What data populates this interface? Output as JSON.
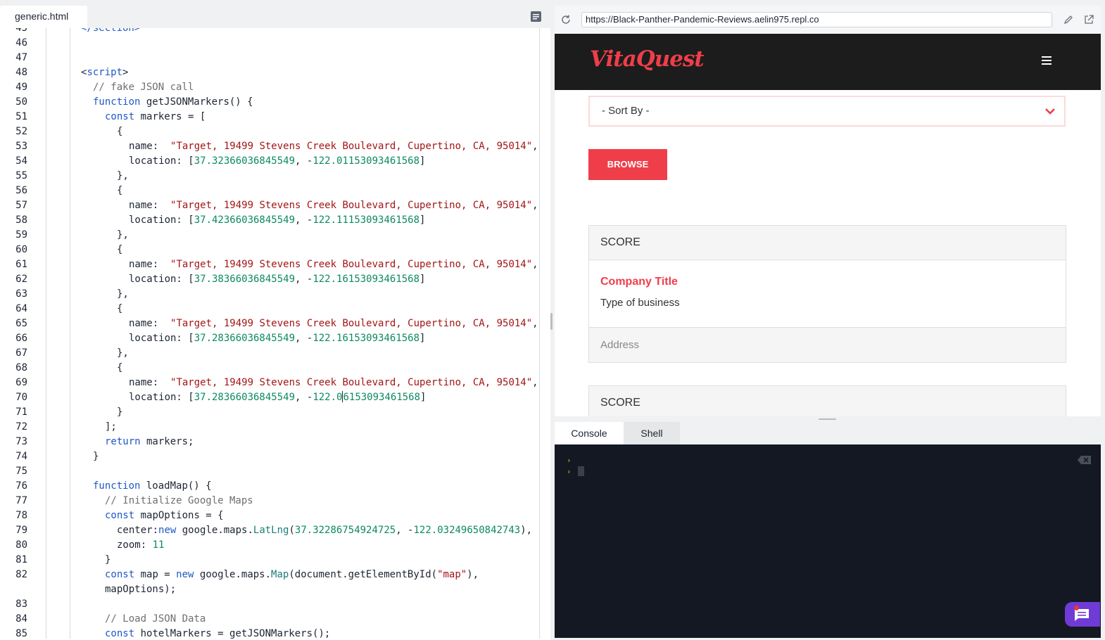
{
  "editor": {
    "tab_label": "generic.html",
    "lines": [
      {
        "n": "45",
        "indent": 0,
        "tokens": [
          {
            "t": "</",
            "c": "tag"
          },
          {
            "t": "section",
            "c": "tag"
          },
          {
            "t": ">",
            "c": "tag"
          }
        ]
      },
      {
        "n": "46",
        "indent": 0,
        "tokens": []
      },
      {
        "n": "47",
        "indent": 0,
        "tokens": []
      },
      {
        "n": "48",
        "indent": 0,
        "tokens": [
          {
            "t": "<",
            "c": "plain"
          },
          {
            "t": "script",
            "c": "tag"
          },
          {
            "t": ">",
            "c": "plain"
          }
        ]
      },
      {
        "n": "49",
        "indent": 1,
        "tokens": [
          {
            "t": "// fake JSON call",
            "c": "cmt"
          }
        ]
      },
      {
        "n": "50",
        "indent": 1,
        "tokens": [
          {
            "t": "function",
            "c": "kw"
          },
          {
            "t": " getJSONMarkers() {",
            "c": "plain"
          }
        ]
      },
      {
        "n": "51",
        "indent": 2,
        "tokens": [
          {
            "t": "const",
            "c": "kw"
          },
          {
            "t": " markers = [",
            "c": "plain"
          }
        ]
      },
      {
        "n": "52",
        "indent": 3,
        "tokens": [
          {
            "t": "{",
            "c": "plain"
          }
        ]
      },
      {
        "n": "53",
        "indent": 4,
        "tokens": [
          {
            "t": "name:  ",
            "c": "plain"
          },
          {
            "t": "\"Target, 19499 Stevens Creek Boulevard, Cupertino, CA, 95014\"",
            "c": "str"
          },
          {
            "t": ",",
            "c": "plain"
          }
        ]
      },
      {
        "n": "54",
        "indent": 4,
        "tokens": [
          {
            "t": "location: [",
            "c": "plain"
          },
          {
            "t": "37.32366036845549",
            "c": "num"
          },
          {
            "t": ", -",
            "c": "plain"
          },
          {
            "t": "122.01153093461568",
            "c": "num"
          },
          {
            "t": "]",
            "c": "plain"
          }
        ]
      },
      {
        "n": "55",
        "indent": 3,
        "tokens": [
          {
            "t": "},",
            "c": "plain"
          }
        ]
      },
      {
        "n": "56",
        "indent": 3,
        "tokens": [
          {
            "t": "{",
            "c": "plain"
          }
        ]
      },
      {
        "n": "57",
        "indent": 4,
        "tokens": [
          {
            "t": "name:  ",
            "c": "plain"
          },
          {
            "t": "\"Target, 19499 Stevens Creek Boulevard, Cupertino, CA, 95014\"",
            "c": "str"
          },
          {
            "t": ",",
            "c": "plain"
          }
        ]
      },
      {
        "n": "58",
        "indent": 4,
        "tokens": [
          {
            "t": "location: [",
            "c": "plain"
          },
          {
            "t": "37.42366036845549",
            "c": "num"
          },
          {
            "t": ", -",
            "c": "plain"
          },
          {
            "t": "122.11153093461568",
            "c": "num"
          },
          {
            "t": "]",
            "c": "plain"
          }
        ]
      },
      {
        "n": "59",
        "indent": 3,
        "tokens": [
          {
            "t": "},",
            "c": "plain"
          }
        ]
      },
      {
        "n": "60",
        "indent": 3,
        "tokens": [
          {
            "t": "{",
            "c": "plain"
          }
        ]
      },
      {
        "n": "61",
        "indent": 4,
        "tokens": [
          {
            "t": "name:  ",
            "c": "plain"
          },
          {
            "t": "\"Target, 19499 Stevens Creek Boulevard, Cupertino, CA, 95014\"",
            "c": "str"
          },
          {
            "t": ",",
            "c": "plain"
          }
        ]
      },
      {
        "n": "62",
        "indent": 4,
        "tokens": [
          {
            "t": "location: [",
            "c": "plain"
          },
          {
            "t": "37.38366036845549",
            "c": "num"
          },
          {
            "t": ", -",
            "c": "plain"
          },
          {
            "t": "122.16153093461568",
            "c": "num"
          },
          {
            "t": "]",
            "c": "plain"
          }
        ]
      },
      {
        "n": "63",
        "indent": 3,
        "tokens": [
          {
            "t": "},",
            "c": "plain"
          }
        ]
      },
      {
        "n": "64",
        "indent": 3,
        "tokens": [
          {
            "t": "{",
            "c": "plain"
          }
        ]
      },
      {
        "n": "65",
        "indent": 4,
        "tokens": [
          {
            "t": "name:  ",
            "c": "plain"
          },
          {
            "t": "\"Target, 19499 Stevens Creek Boulevard, Cupertino, CA, 95014\"",
            "c": "str"
          },
          {
            "t": ",",
            "c": "plain"
          }
        ]
      },
      {
        "n": "66",
        "indent": 4,
        "tokens": [
          {
            "t": "location: [",
            "c": "plain"
          },
          {
            "t": "37.28366036845549",
            "c": "num"
          },
          {
            "t": ", -",
            "c": "plain"
          },
          {
            "t": "122.16153093461568",
            "c": "num"
          },
          {
            "t": "]",
            "c": "plain"
          }
        ]
      },
      {
        "n": "67",
        "indent": 3,
        "tokens": [
          {
            "t": "},",
            "c": "plain"
          }
        ]
      },
      {
        "n": "68",
        "indent": 3,
        "tokens": [
          {
            "t": "{",
            "c": "plain"
          }
        ]
      },
      {
        "n": "69",
        "indent": 4,
        "tokens": [
          {
            "t": "name:  ",
            "c": "plain"
          },
          {
            "t": "\"Target, 19499 Stevens Creek Boulevard, Cupertino, CA, 95014\"",
            "c": "str"
          },
          {
            "t": ",",
            "c": "plain"
          }
        ]
      },
      {
        "n": "70",
        "indent": 4,
        "tokens": [
          {
            "t": "location: [",
            "c": "plain"
          },
          {
            "t": "37.28366036845549",
            "c": "num"
          },
          {
            "t": ", -",
            "c": "plain"
          },
          {
            "t": "122.0",
            "c": "num"
          },
          {
            "t": "",
            "c": "caret"
          },
          {
            "t": "6153093461568",
            "c": "num"
          },
          {
            "t": "]",
            "c": "plain"
          }
        ]
      },
      {
        "n": "71",
        "indent": 3,
        "tokens": [
          {
            "t": "}",
            "c": "plain"
          }
        ]
      },
      {
        "n": "72",
        "indent": 2,
        "tokens": [
          {
            "t": "];",
            "c": "plain"
          }
        ]
      },
      {
        "n": "73",
        "indent": 2,
        "tokens": [
          {
            "t": "return",
            "c": "kw"
          },
          {
            "t": " markers;",
            "c": "plain"
          }
        ]
      },
      {
        "n": "74",
        "indent": 1,
        "tokens": [
          {
            "t": "}",
            "c": "plain"
          }
        ]
      },
      {
        "n": "75",
        "indent": 0,
        "tokens": []
      },
      {
        "n": "76",
        "indent": 1,
        "tokens": [
          {
            "t": "function",
            "c": "kw"
          },
          {
            "t": " loadMap() {",
            "c": "plain"
          }
        ]
      },
      {
        "n": "77",
        "indent": 2,
        "tokens": [
          {
            "t": "// Initialize Google Maps",
            "c": "cmt"
          }
        ]
      },
      {
        "n": "78",
        "indent": 2,
        "tokens": [
          {
            "t": "const",
            "c": "kw"
          },
          {
            "t": " mapOptions = {",
            "c": "plain"
          }
        ]
      },
      {
        "n": "79",
        "indent": 3,
        "tokens": [
          {
            "t": "center:",
            "c": "plain"
          },
          {
            "t": "new",
            "c": "kw"
          },
          {
            "t": " google.maps.",
            "c": "plain"
          },
          {
            "t": "LatLng",
            "c": "type"
          },
          {
            "t": "(",
            "c": "plain"
          },
          {
            "t": "37.32286754924725",
            "c": "num"
          },
          {
            "t": ", -",
            "c": "plain"
          },
          {
            "t": "122.03249650842743",
            "c": "num"
          },
          {
            "t": "),",
            "c": "plain"
          }
        ]
      },
      {
        "n": "80",
        "indent": 3,
        "tokens": [
          {
            "t": "zoom: ",
            "c": "plain"
          },
          {
            "t": "11",
            "c": "num"
          }
        ]
      },
      {
        "n": "81",
        "indent": 2,
        "tokens": [
          {
            "t": "}",
            "c": "plain"
          }
        ]
      },
      {
        "n": "82",
        "indent": 2,
        "wrap": true,
        "tokens": [
          {
            "t": "const",
            "c": "kw"
          },
          {
            "t": " map = ",
            "c": "plain"
          },
          {
            "t": "new",
            "c": "kw"
          },
          {
            "t": " google.maps.",
            "c": "plain"
          },
          {
            "t": "Map",
            "c": "type"
          },
          {
            "t": "(document.getElementById(",
            "c": "plain"
          },
          {
            "t": "\"map\"",
            "c": "str"
          },
          {
            "t": "),\nmapOptions);",
            "c": "plain"
          }
        ]
      },
      {
        "n": "83",
        "indent": 0,
        "tokens": []
      },
      {
        "n": "84",
        "indent": 2,
        "tokens": [
          {
            "t": "// Load JSON Data",
            "c": "cmt"
          }
        ]
      },
      {
        "n": "85",
        "indent": 2,
        "tokens": [
          {
            "t": "const",
            "c": "kw"
          },
          {
            "t": " hotelMarkers = getJSONMarkers();",
            "c": "plain"
          }
        ]
      }
    ]
  },
  "browser": {
    "url": "https://Black-Panther-Pandemic-Reviews.aelin975.repl.co",
    "site": {
      "logo": "VitaQuest",
      "sort_placeholder": "- Sort By -",
      "browse_label": "BROWSE",
      "cards": [
        {
          "score": "SCORE",
          "title": "Company Title",
          "type": "Type of business",
          "address": "Address"
        },
        {
          "score": "SCORE"
        }
      ]
    }
  },
  "console": {
    "tabs": [
      {
        "label": "Console",
        "active": true
      },
      {
        "label": "Shell",
        "active": false
      }
    ],
    "prompt_glyph": "›"
  },
  "colors": {
    "accent": "#ef3e4a",
    "navbar": "#1c1c1c",
    "console_bg": "#141823",
    "chat": "#6f3bd6"
  }
}
